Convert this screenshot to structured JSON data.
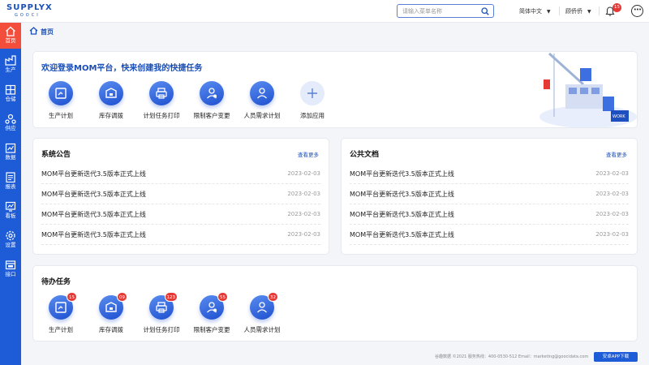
{
  "header": {
    "logo_main": "SUPPLYX",
    "logo_sub": "GOOCI",
    "search_placeholder": "请输入菜单名称",
    "language": "简体中文",
    "username": "顾侨侨",
    "notification_count": "15",
    "more_icon": "more-icon"
  },
  "sidebar": {
    "items": [
      {
        "label": "首页",
        "icon": "home-icon",
        "active": true
      },
      {
        "label": "生产",
        "icon": "production-icon"
      },
      {
        "label": "仓储",
        "icon": "warehouse-icon"
      },
      {
        "label": "供应",
        "icon": "supply-icon"
      },
      {
        "label": "数据",
        "icon": "data-icon"
      },
      {
        "label": "报表",
        "icon": "report-icon"
      },
      {
        "label": "看板",
        "icon": "dashboard-icon"
      },
      {
        "label": "设置",
        "icon": "settings-icon"
      },
      {
        "label": "接口",
        "icon": "interface-icon"
      }
    ]
  },
  "breadcrumb": {
    "label": "首页"
  },
  "welcome": {
    "title": "欢迎登录MOM平台，快来创建我的快捷任务",
    "quick_actions": [
      {
        "label": "生产计划",
        "icon": "production-plan-icon"
      },
      {
        "label": "库存调拨",
        "icon": "inventory-transfer-icon"
      },
      {
        "label": "计划任务打印",
        "icon": "printer-icon"
      },
      {
        "label": "限制客户变更",
        "icon": "customer-restrict-icon"
      },
      {
        "label": "人员需求计划",
        "icon": "staff-plan-icon"
      },
      {
        "label": "添加应用",
        "icon": "add-icon"
      }
    ]
  },
  "announcements": {
    "title": "系统公告",
    "more": "查看更多",
    "rows": [
      {
        "title": "MOM平台更新迭代3.5版本正式上线",
        "date": "2023-02-03"
      },
      {
        "title": "MOM平台更新迭代3.5版本正式上线",
        "date": "2023-02-03"
      },
      {
        "title": "MOM平台更新迭代3.5版本正式上线",
        "date": "2023-02-03"
      },
      {
        "title": "MOM平台更新迭代3.5版本正式上线",
        "date": "2023-02-03"
      }
    ]
  },
  "documents": {
    "title": "公共文档",
    "more": "查看更多",
    "rows": [
      {
        "title": "MOM平台更新迭代3.5版本正式上线",
        "date": "2023-02-03"
      },
      {
        "title": "MOM平台更新迭代3.5版本正式上线",
        "date": "2023-02-03"
      },
      {
        "title": "MOM平台更新迭代3.5版本正式上线",
        "date": "2023-02-03"
      },
      {
        "title": "MOM平台更新迭代3.5版本正式上线",
        "date": "2023-02-03"
      }
    ]
  },
  "todo": {
    "title": "待办任务",
    "items": [
      {
        "label": "生产计划",
        "count": "15"
      },
      {
        "label": "库存调拨",
        "count": "09"
      },
      {
        "label": "计划任务打印",
        "count": "123"
      },
      {
        "label": "限制客户变更",
        "count": "55"
      },
      {
        "label": "人员需求计划",
        "count": "32"
      }
    ]
  },
  "footer": {
    "text": "谷趣数据 ©2021 服务热线：400-0530-512 Email：marketing@goocidata.com",
    "app_button": "安卓APP下载"
  },
  "illustration_label": "WORK",
  "colors": {
    "primary": "#1e5bd7",
    "active": "#f34e3c",
    "badge": "#e53935"
  }
}
